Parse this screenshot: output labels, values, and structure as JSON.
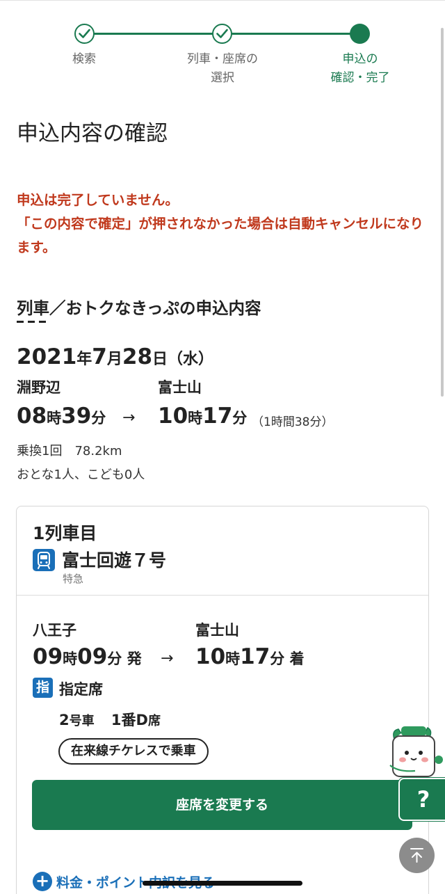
{
  "stepper": {
    "steps": [
      {
        "label": "検索",
        "state": "done"
      },
      {
        "label": "列車・座席の\n選択",
        "state": "done"
      },
      {
        "label": "申込の\n確認・完了",
        "state": "active"
      }
    ]
  },
  "page_title": "申込内容の確認",
  "warning": {
    "line1": "申込は完了していません。",
    "line2": "「この内容で確定」が押されなかった場合は自動キャンセルになります。"
  },
  "section_title": "列車／おトクなきっぷの申込内容",
  "trip": {
    "date": {
      "year": "2021",
      "year_unit": "年",
      "month": "7",
      "month_unit": "月",
      "day": "28",
      "day_unit": "日",
      "weekday": "（水）"
    },
    "from_station": "淵野辺",
    "to_station": "富士山",
    "depart": {
      "hour": "08",
      "hour_unit": "時",
      "min": "39",
      "min_unit": "分"
    },
    "arrive": {
      "hour": "10",
      "hour_unit": "時",
      "min": "17",
      "min_unit": "分"
    },
    "arrow": "→",
    "duration": "（1時間38分）",
    "transfer_distance": "乗換1回　78.2km",
    "passengers": "おとな1人、こども0人"
  },
  "leg": {
    "car_label": "1列車目",
    "train_name": "富士回遊７号",
    "train_type": "特急",
    "from_station": "八王子",
    "to_station": "富士山",
    "depart": {
      "hour": "09",
      "hour_unit": "時",
      "min": "09",
      "min_unit": "分",
      "suffix": "発"
    },
    "arrive": {
      "hour": "10",
      "hour_unit": "時",
      "min": "17",
      "min_unit": "分",
      "suffix": "着"
    },
    "arrow": "→",
    "seat_icon": "指",
    "seat_class": "指定席",
    "car_no": "2",
    "car_unit": "号車",
    "seat_no": "1番D",
    "seat_unit": "席",
    "ticketless_badge": "在来線チケレスで乗車",
    "change_seat_button": "座席を変更する",
    "fee_link": "料金・ポイント内訳を見る"
  },
  "help": {
    "label": "?"
  },
  "colors": {
    "brand_green": "#1a7a50",
    "warning_red": "#c0391d",
    "link_blue": "#1a6fb8"
  }
}
